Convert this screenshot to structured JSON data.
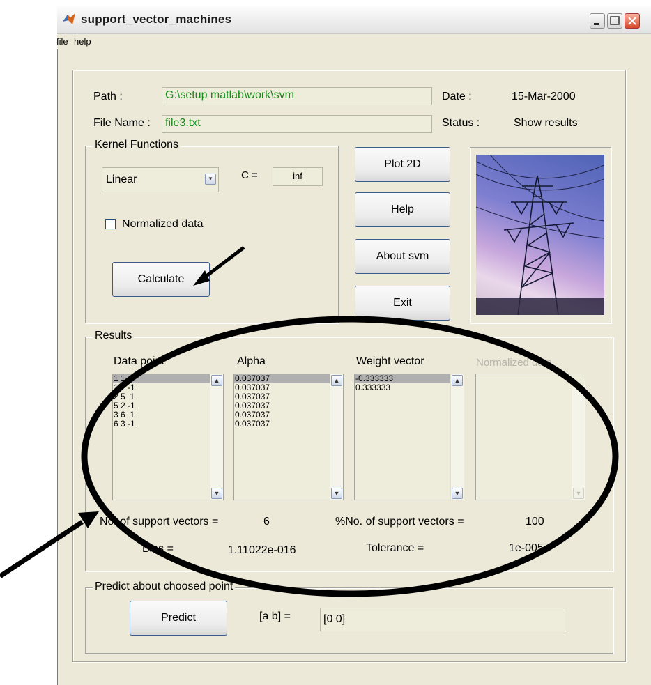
{
  "window": {
    "title": "support_vector_machines",
    "menu": [
      "file",
      "help"
    ]
  },
  "header": {
    "path_label": "Path :",
    "path_value": "G:\\setup matlab\\work\\svm",
    "filename_label": "File Name :",
    "filename_value": "file3.txt",
    "date_label": "Date :",
    "date_value": "15-Mar-2000",
    "status_label": "Status :",
    "status_value": "Show results"
  },
  "kernel": {
    "frame_title": "Kernel Functions",
    "selected": "Linear",
    "c_label": "C =",
    "c_value": "inf",
    "normalized_label": "Normalized data",
    "normalized_checked": false,
    "calculate_label": "Calculate"
  },
  "actions": {
    "plot2d": "Plot 2D",
    "help": "Help",
    "about": "About svm",
    "exit": "Exit"
  },
  "results": {
    "frame_title": "Results",
    "headers": {
      "data_point": "Data point",
      "alpha": "Alpha",
      "weight": "Weight vector",
      "normalized": "Normalized data"
    },
    "data_points": [
      "1 1  1",
      "1 1 -1",
      "2 5  1",
      "5 2 -1",
      "3 6  1",
      "6 3 -1"
    ],
    "alpha": [
      "0.037037",
      "0.037037",
      "0.037037",
      "0.037037",
      "0.037037",
      "0.037037"
    ],
    "weight_vector": [
      "-0.333333",
      "0.333333"
    ],
    "n_sv_label": "No. of support vectors =",
    "n_sv_value": "6",
    "pct_sv_label": "%No. of support vectors =",
    "pct_sv_value": "100",
    "bias_label": "Bias =",
    "bias_value": "1.11022e-016",
    "tolerance_label": "Tolerance =",
    "tolerance_value": "1e-005"
  },
  "predict": {
    "frame_title": "Predict about choosed point",
    "button_label": "Predict",
    "ab_label": "[a   b]  =",
    "ab_value": "[0 0]"
  },
  "colors": {
    "window_bg": "#ece9d8",
    "field_bg": "#eeeddc",
    "path_text": "#1a8a1a",
    "button_border": "#3c5a8c",
    "annotation": "#000000"
  }
}
